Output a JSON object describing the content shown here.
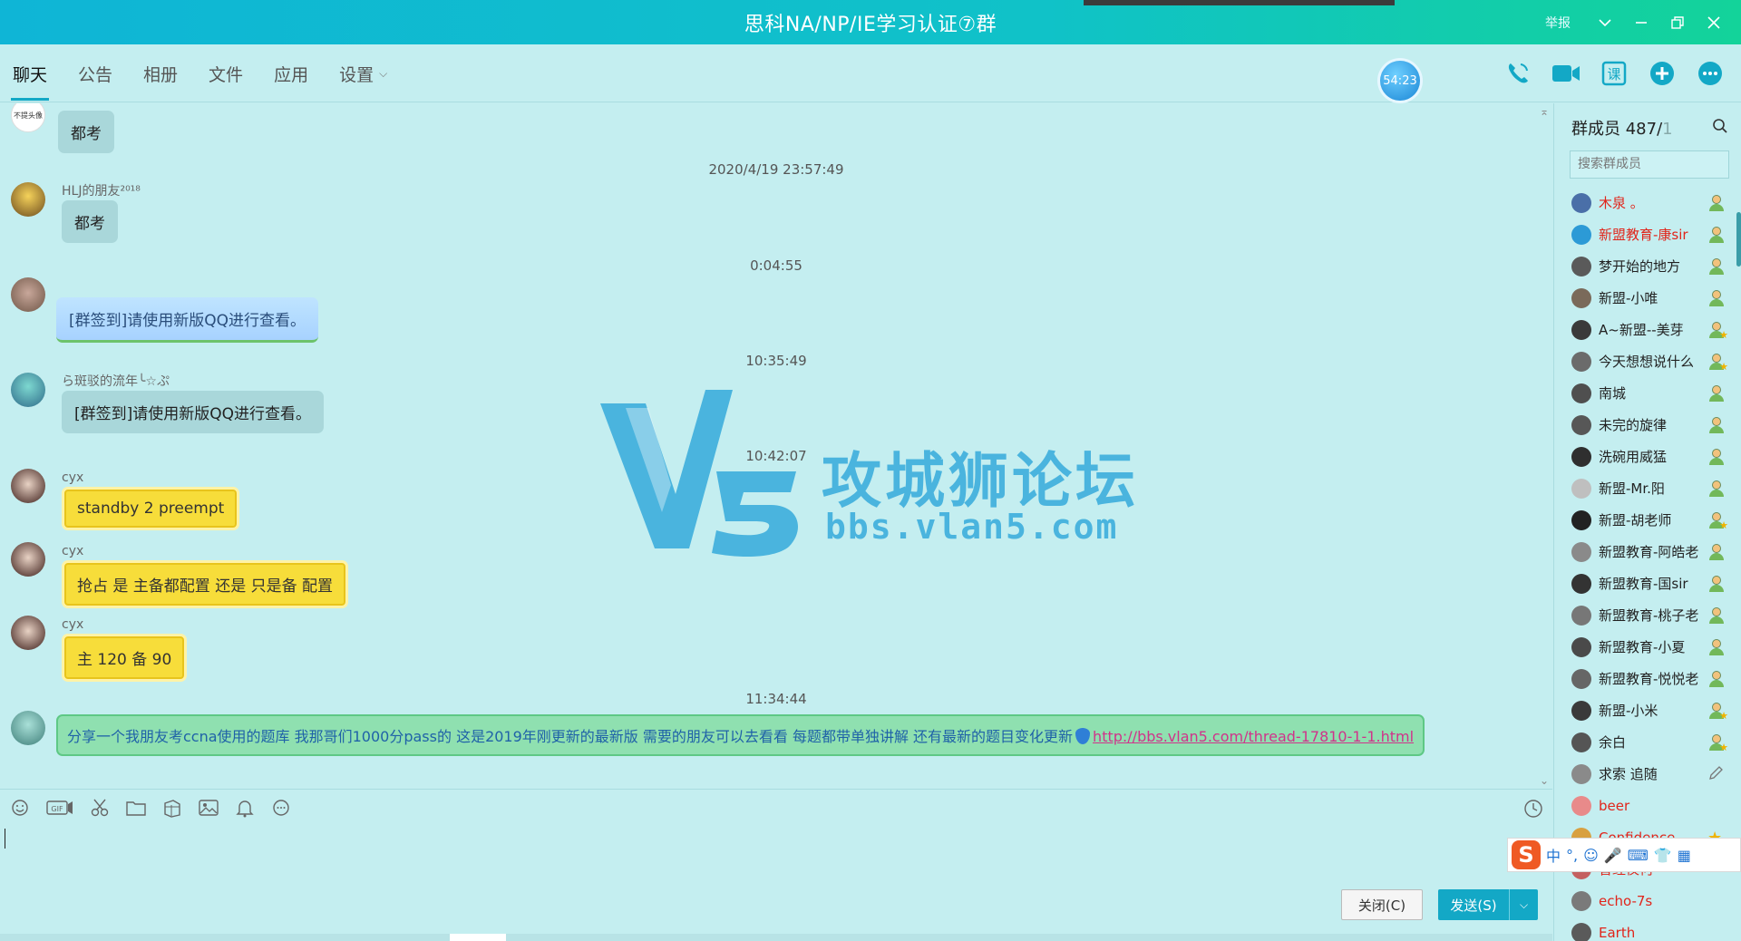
{
  "window": {
    "title": "思科NA/NP/IE学习认证⑦群",
    "report_label": "举报"
  },
  "tabs": [
    {
      "label": "聊天"
    },
    {
      "label": "公告"
    },
    {
      "label": "相册"
    },
    {
      "label": "文件"
    },
    {
      "label": "应用"
    },
    {
      "label": "设置"
    }
  ],
  "toolbar": {
    "timer": "54:23",
    "icons": [
      "phone-icon",
      "video-icon",
      "class-icon",
      "add-icon",
      "more-icon"
    ]
  },
  "chat": {
    "messages": [
      {
        "kind": "msg",
        "avatar_label": "不提头像",
        "sender": "",
        "text": "都考",
        "style": "plain"
      },
      {
        "kind": "ts",
        "text": "2020/4/19 23:57:49"
      },
      {
        "kind": "msg",
        "sender": "HLJ的朋友²⁰¹⁸",
        "text": "都考",
        "style": "plain"
      },
      {
        "kind": "ts",
        "text": "0:04:55"
      },
      {
        "kind": "msg",
        "sender": "",
        "text": "[群签到]请使用新版QQ进行查看。",
        "style": "blue"
      },
      {
        "kind": "ts",
        "text": "10:35:49"
      },
      {
        "kind": "msg",
        "sender": "ら斑驳的流年╰☆ぷ",
        "text": "[群签到]请使用新版QQ进行查看。",
        "style": "plain"
      },
      {
        "kind": "ts",
        "text": "10:42:07"
      },
      {
        "kind": "msg",
        "sender": "cyx",
        "text": "standby 2 preempt",
        "style": "yellow"
      },
      {
        "kind": "msg",
        "sender": "cyx",
        "text": "抢占 是 主备都配置 还是  只是备 配置",
        "style": "yellow"
      },
      {
        "kind": "msg",
        "sender": "cyx",
        "text": "主  120   备 90",
        "style": "yellow"
      },
      {
        "kind": "ts",
        "text": "11:34:44"
      },
      {
        "kind": "msg",
        "sender": "",
        "text": "分享一个我朋友考ccna使用的题库 我那哥们1000分pass的 这是2019年刚更新的最新版 需要的朋友可以去看看 每题都带单独讲解 还有最新的题目变化更新",
        "link": "http://bbs.vlan5.com/thread-17810-1-1.html",
        "style": "green"
      }
    ]
  },
  "watermark": {
    "title": "攻城狮论坛",
    "url": "bbs.vlan5.com"
  },
  "input": {
    "close_label": "关闭(C)",
    "send_label": "发送(S)"
  },
  "members": {
    "header_label": "群成员 487/",
    "header_muted": "1",
    "search_placeholder": "搜索群成员",
    "list": [
      {
        "name": "木泉 。",
        "red": true,
        "role": "admin"
      },
      {
        "name": "新盟教育-康sir",
        "red": true,
        "role": "admin"
      },
      {
        "name": "梦开始的地方",
        "red": false,
        "role": "admin"
      },
      {
        "name": "新盟-小唯",
        "red": false,
        "role": "admin"
      },
      {
        "name": "A~新盟--美芽",
        "red": false,
        "role": "admin-star"
      },
      {
        "name": "今天想想说什么",
        "red": false,
        "role": "admin-star"
      },
      {
        "name": "南城",
        "red": false,
        "role": "admin"
      },
      {
        "name": "未完的旋律",
        "red": false,
        "role": "admin"
      },
      {
        "name": "洗碗用威猛",
        "red": false,
        "role": "admin"
      },
      {
        "name": "新盟-Mr.阳",
        "red": false,
        "role": "admin"
      },
      {
        "name": "新盟-胡老师",
        "red": false,
        "role": "admin-star"
      },
      {
        "name": "新盟教育-阿皓老",
        "red": false,
        "role": "admin"
      },
      {
        "name": "新盟教育-国sir",
        "red": false,
        "role": "admin"
      },
      {
        "name": "新盟教育-桃子老",
        "red": false,
        "role": "admin"
      },
      {
        "name": "新盟教育-小夏",
        "red": false,
        "role": "admin"
      },
      {
        "name": "新盟教育-悦悦老",
        "red": false,
        "role": "admin"
      },
      {
        "name": "新盟-小米",
        "red": false,
        "role": "admin-star"
      },
      {
        "name": "余白",
        "red": false,
        "role": "admin-star"
      },
      {
        "name": "求索 追随",
        "red": false,
        "role": "edit"
      },
      {
        "name": "beer",
        "red": true,
        "role": "none"
      },
      {
        "name": "Confidence",
        "red": true,
        "role": "star"
      },
      {
        "name": "曾经仪何",
        "red": true,
        "role": "none"
      },
      {
        "name": "echo-7s",
        "red": true,
        "role": "none"
      },
      {
        "name": "Earth",
        "red": true,
        "role": "none"
      }
    ]
  },
  "ime": {
    "logo": "S",
    "items": [
      "中",
      "°,",
      "☺",
      "🎤",
      "⌨",
      "👕",
      "▦"
    ]
  }
}
